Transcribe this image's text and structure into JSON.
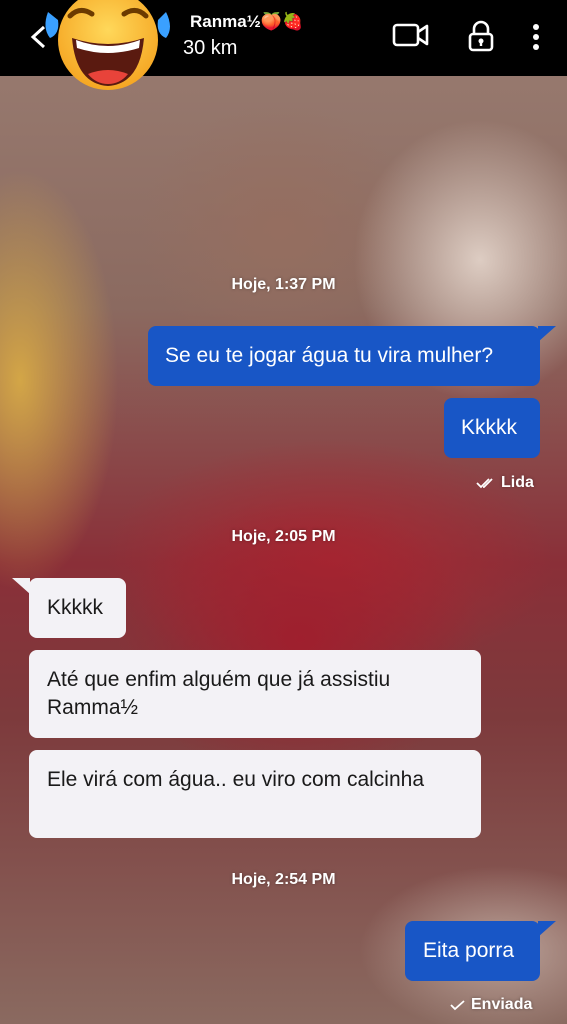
{
  "header": {
    "contact_name": "Ranma½🍑🍓",
    "distance": "30 km",
    "avatar_icon": "laughing-tears-emoji-icon",
    "video_icon": "video-camera-icon",
    "lock_icon": "lock-icon",
    "menu_icon": "more-vertical-icon",
    "back_icon": "chevron-left-icon"
  },
  "colors": {
    "header_bg": "#000000",
    "outgoing_bubble": "#1856c6",
    "incoming_bubble": "#f3f2f6"
  },
  "messages": [
    {
      "date": "Hoje, 1:37 PM"
    },
    {
      "direction": "out",
      "text": "Se eu te jogar água tu vira mulher?"
    },
    {
      "direction": "out",
      "text": "Kkkkk",
      "status": "Lida"
    },
    {
      "date": "Hoje, 2:05 PM"
    },
    {
      "direction": "in",
      "text": "Kkkkk"
    },
    {
      "direction": "in",
      "text": "Até que enfim alguém que já assistiu Ramma½"
    },
    {
      "direction": "in",
      "text": "Ele virá com água..  eu viro com calcinha"
    },
    {
      "date": "Hoje, 2:54 PM"
    },
    {
      "direction": "out",
      "text": "Eita porra",
      "status": "Enviada"
    }
  ]
}
